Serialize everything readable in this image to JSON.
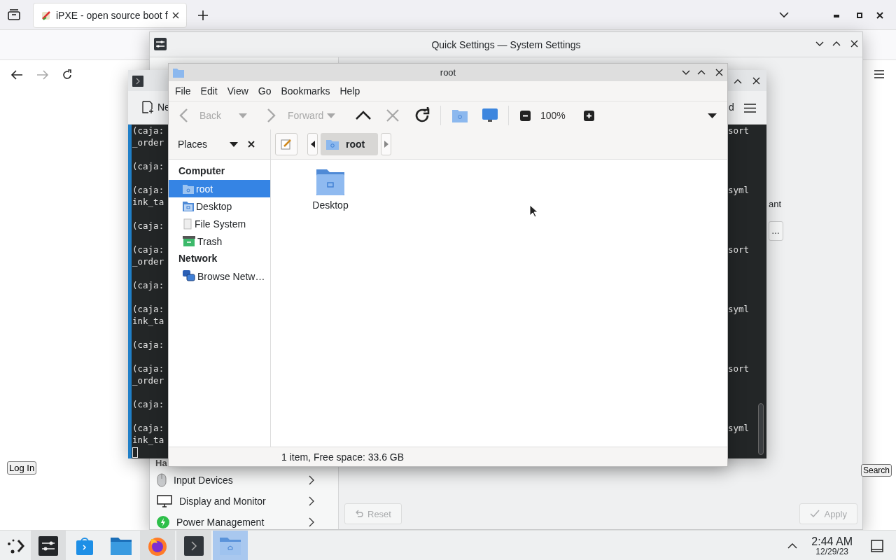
{
  "browser": {
    "tab": {
      "title": "iPXE - open source boot f"
    },
    "login_button": "Log In",
    "search_button": "Search"
  },
  "settings": {
    "title": "Quick Settings — System Settings",
    "section_header": "Ha",
    "categories": [
      {
        "label": "Input Devices",
        "kind": "mouse"
      },
      {
        "label": "Display and Monitor",
        "kind": "monitor"
      },
      {
        "label": "Power Management",
        "kind": "power"
      }
    ],
    "partial_label": "ant",
    "more_button": "…",
    "reset_button": {
      "label": "Reset",
      "disabled": true
    },
    "apply_button": {
      "label": "Apply",
      "disabled": true
    }
  },
  "terminal": {
    "toolbar_label": "Ne",
    "toolbar_label_right": "d",
    "blocks": [
      {
        "lines": [
          "(caja:",
          "_order"
        ],
        "tail": "sort"
      },
      {
        "lines": [
          "(caja:"
        ]
      },
      {
        "lines": [
          "(caja:",
          "ink_ta"
        ],
        "tail": "syml"
      },
      {
        "lines": [
          "(caja:"
        ]
      },
      {
        "lines": [
          "(caja:",
          "_order"
        ],
        "tail": "sort"
      },
      {
        "lines": [
          "(caja:"
        ]
      },
      {
        "lines": [
          "(caja:",
          "ink_ta"
        ],
        "tail": "syml"
      },
      {
        "lines": [
          "(caja:"
        ]
      },
      {
        "lines": [
          "(caja:",
          "_order"
        ],
        "tail": "sort"
      },
      {
        "lines": [
          "(caja:"
        ]
      },
      {
        "lines": [
          "(caja:",
          "ink_ta"
        ],
        "tail": "syml"
      }
    ]
  },
  "file_manager": {
    "title": "root",
    "menu": [
      "File",
      "Edit",
      "View",
      "Go",
      "Bookmarks",
      "Help"
    ],
    "toolbar": {
      "back": {
        "label": "Back",
        "disabled": true
      },
      "forward": {
        "label": "Forward",
        "disabled": true
      },
      "stop": {
        "disabled": true
      },
      "zoom": "100%"
    },
    "places_label": "Places",
    "breadcrumbs": [
      {
        "label": "root",
        "selected": true
      }
    ],
    "sidebar": [
      {
        "heading": "Computer",
        "items": [
          {
            "label": "root",
            "kind": "home",
            "selected": true
          },
          {
            "label": "Desktop",
            "kind": "desktop",
            "selected": false
          },
          {
            "label": "File System",
            "kind": "drive",
            "selected": false
          },
          {
            "label": "Trash",
            "kind": "trash",
            "selected": false
          }
        ]
      },
      {
        "heading": "Network",
        "items": [
          {
            "label": "Browse Netw…",
            "kind": "network",
            "selected": false
          }
        ]
      }
    ],
    "files": [
      {
        "name": "Desktop",
        "kind": "folder"
      }
    ],
    "status": "1 item, Free space: 33.6 GB"
  },
  "taskbar": {
    "apps": [
      {
        "kind": "settings",
        "open": true,
        "selected": false
      },
      {
        "kind": "store",
        "open": false,
        "selected": false
      },
      {
        "kind": "files",
        "open": false,
        "selected": false
      },
      {
        "kind": "firefox",
        "open": true,
        "selected": false
      },
      {
        "kind": "terminal",
        "open": true,
        "selected": false
      },
      {
        "kind": "filemanager",
        "open": true,
        "selected": true
      }
    ],
    "clock": {
      "time": "2:44 AM",
      "date": "12/29/23"
    }
  }
}
